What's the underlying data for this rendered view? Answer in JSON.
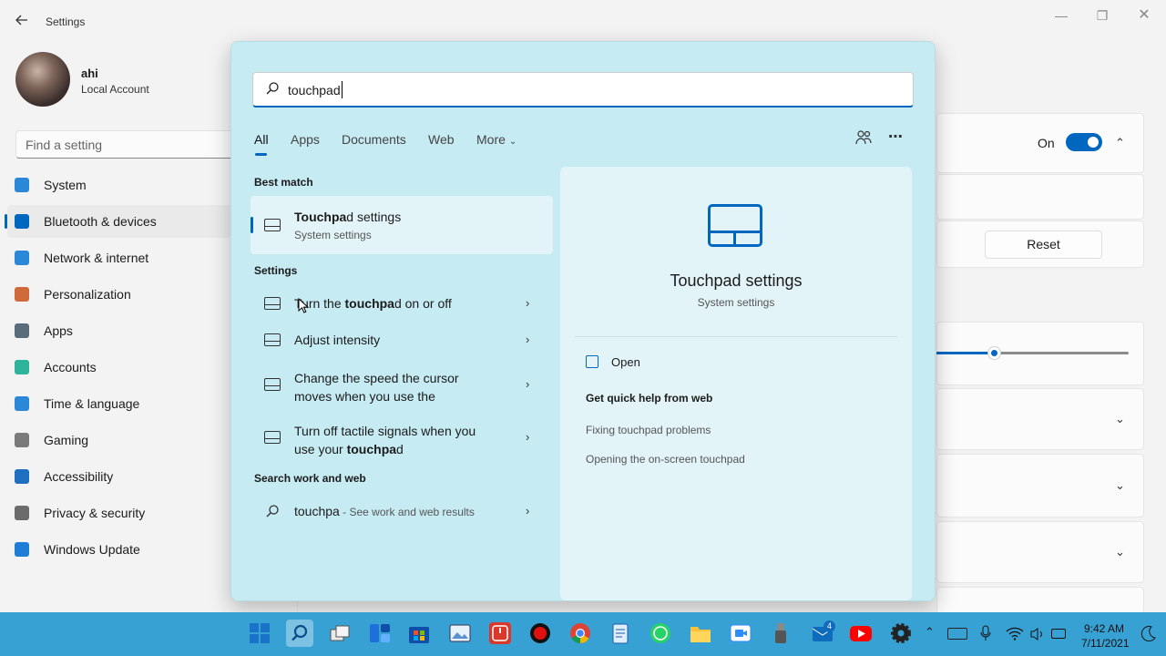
{
  "window": {
    "title": "Settings"
  },
  "user": {
    "name": "ahi",
    "type": "Local Account"
  },
  "find": {
    "placeholder": "Find a setting"
  },
  "nav": [
    {
      "label": "System",
      "color": "#2b88d8"
    },
    {
      "label": "Bluetooth & devices",
      "color": "#0067c0"
    },
    {
      "label": "Network & internet",
      "color": "#2b88d8"
    },
    {
      "label": "Personalization",
      "color": "#d06a3a"
    },
    {
      "label": "Apps",
      "color": "#5a6b7b"
    },
    {
      "label": "Accounts",
      "color": "#2fb39a"
    },
    {
      "label": "Time & language",
      "color": "#2b88d8"
    },
    {
      "label": "Gaming",
      "color": "#7a7a7a"
    },
    {
      "label": "Accessibility",
      "color": "#1f6fc0"
    },
    {
      "label": "Privacy & security",
      "color": "#6b6b6b"
    },
    {
      "label": "Windows Update",
      "color": "#1e7ed6"
    }
  ],
  "right": {
    "toggle_label": "On",
    "reset_label": "Reset",
    "slider_level": 0.3
  },
  "search": {
    "query": "touchpad",
    "tabs": [
      "All",
      "Apps",
      "Documents",
      "Web",
      "More"
    ],
    "best_match_header": "Best match",
    "best_match": {
      "pre": "Touchpa",
      "post": "d settings",
      "sub": "System settings"
    },
    "settings_header": "Settings",
    "settings": [
      {
        "a": "Turn the ",
        "b": "touchpa",
        "c": "d on or off"
      },
      {
        "a": "Adjust intensity",
        "b": "",
        "c": ""
      },
      {
        "a": "Change the speed the cursor moves when you use the",
        "b": "",
        "c": ""
      },
      {
        "a": "Turn off tactile signals when you use your ",
        "b": "touchpa",
        "c": "d"
      }
    ],
    "web_header": "Search work and web",
    "web": {
      "query": "touchpa",
      "hint": " - See work and web results"
    }
  },
  "preview": {
    "title": "Touchpad settings",
    "sub": "System settings",
    "open": "Open",
    "quick_help": "Get quick help from web",
    "links": [
      "Fixing touchpad problems",
      "Opening the on-screen touchpad"
    ]
  },
  "taskbar": {
    "time": "9:42 AM",
    "date": "7/11/2021",
    "badge": "4"
  },
  "colors": {
    "accent": "#0067c0",
    "flyout": "#c6ebf3",
    "taskbar": "#38a1d3"
  }
}
